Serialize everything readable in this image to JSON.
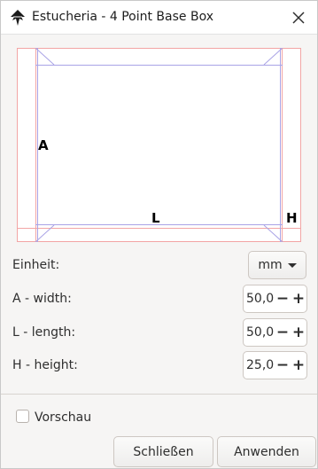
{
  "titlebar": {
    "title": "Estucheria - 4 Point Base Box",
    "app_icon": "inkscape-icon",
    "close_icon": "close-icon"
  },
  "preview": {
    "label_a": "A",
    "label_l": "L",
    "label_h": "H",
    "colors": {
      "cut_line": "#f2a5a5",
      "fold_line": "#a9a3e6"
    }
  },
  "form": {
    "unit": {
      "label": "Einheit:",
      "value": "mm"
    },
    "width": {
      "label": "A - width:",
      "value": "50,0"
    },
    "length": {
      "label": "L - length:",
      "value": "50,0"
    },
    "height": {
      "label": "H - height:",
      "value": "25,0"
    },
    "minus_symbol": "−",
    "plus_symbol": "+"
  },
  "footer": {
    "preview_label": "Vorschau",
    "preview_checked": false,
    "close_label": "Schließen",
    "apply_label": "Anwenden"
  }
}
